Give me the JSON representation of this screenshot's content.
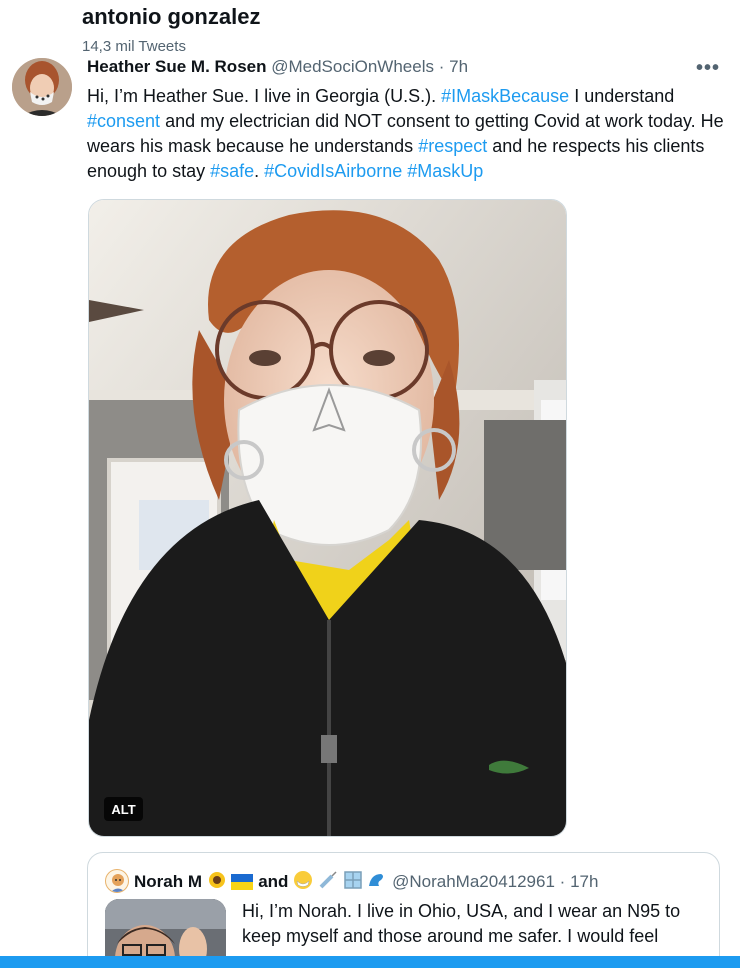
{
  "header": {
    "name": "antonio gonzalez",
    "tweet_count": "14,3 mil Tweets"
  },
  "tweet": {
    "author_name": "Heather Sue M. Rosen",
    "author_handle": "@MedSociOnWheels",
    "dot": "·",
    "time": "7h",
    "more_label": "•••",
    "text_parts": {
      "p1": "Hi, I’m Heather Sue. I live in Georgia (U.S.). ",
      "t1": "#IMaskBecause",
      "p2": " I understand ",
      "t2": "#consent",
      "p3": " and my electrician did NOT consent to getting Covid at work today. He wears his mask because he understands ",
      "t3": "#respect",
      "p4": " and he respects his clients enough to stay ",
      "t4": "#safe",
      "p5": ". ",
      "t5": "#CovidIsAirborne",
      "p6": " ",
      "t6": "#MaskUp"
    },
    "photo_badge": "ALT"
  },
  "quote": {
    "name": "Norah M",
    "and_text": "and",
    "handle": "@NorahMa20412961",
    "dot": "·",
    "time": "17h",
    "text": "Hi, I’m Norah. I live in Ohio, USA, and I wear an N95 to keep myself and those around me safer. I would feel"
  },
  "colors": {
    "accent": "#1d9bf0",
    "text": "#0f1419",
    "muted": "#536471",
    "border": "#cfd9de"
  }
}
